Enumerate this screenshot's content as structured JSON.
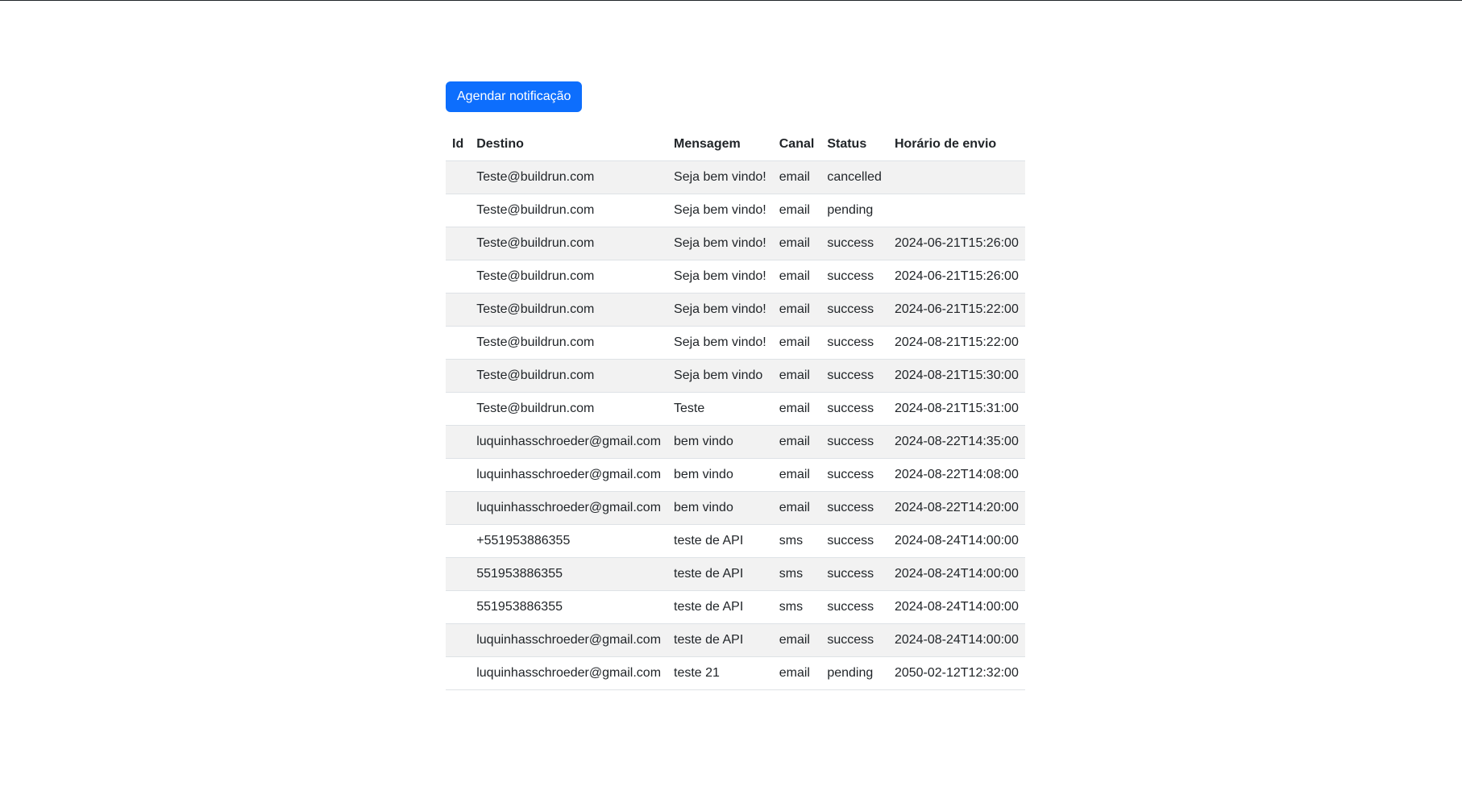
{
  "toolbar": {
    "schedule_label": "Agendar notificação"
  },
  "table": {
    "headers": [
      "Id",
      "Destino",
      "Mensagem",
      "Canal",
      "Status",
      "Horário de envio"
    ],
    "rows": [
      {
        "id": "",
        "destino": "Teste@buildrun.com",
        "mensagem": "Seja bem vindo!",
        "canal": "email",
        "status": "cancelled",
        "horario": ""
      },
      {
        "id": "",
        "destino": "Teste@buildrun.com",
        "mensagem": "Seja bem vindo!",
        "canal": "email",
        "status": "pending",
        "horario": ""
      },
      {
        "id": "",
        "destino": "Teste@buildrun.com",
        "mensagem": "Seja bem vindo!",
        "canal": "email",
        "status": "success",
        "horario": "2024-06-21T15:26:00"
      },
      {
        "id": "",
        "destino": "Teste@buildrun.com",
        "mensagem": "Seja bem vindo!",
        "canal": "email",
        "status": "success",
        "horario": "2024-06-21T15:26:00"
      },
      {
        "id": "",
        "destino": "Teste@buildrun.com",
        "mensagem": "Seja bem vindo!",
        "canal": "email",
        "status": "success",
        "horario": "2024-06-21T15:22:00"
      },
      {
        "id": "",
        "destino": "Teste@buildrun.com",
        "mensagem": "Seja bem vindo!",
        "canal": "email",
        "status": "success",
        "horario": "2024-08-21T15:22:00"
      },
      {
        "id": "",
        "destino": "Teste@buildrun.com",
        "mensagem": "Seja bem vindo",
        "canal": "email",
        "status": "success",
        "horario": "2024-08-21T15:30:00"
      },
      {
        "id": "",
        "destino": "Teste@buildrun.com",
        "mensagem": "Teste",
        "canal": "email",
        "status": "success",
        "horario": "2024-08-21T15:31:00"
      },
      {
        "id": "",
        "destino": "luquinhasschroeder@gmail.com",
        "mensagem": "bem vindo",
        "canal": "email",
        "status": "success",
        "horario": "2024-08-22T14:35:00"
      },
      {
        "id": "",
        "destino": "luquinhasschroeder@gmail.com",
        "mensagem": "bem vindo",
        "canal": "email",
        "status": "success",
        "horario": "2024-08-22T14:08:00"
      },
      {
        "id": "",
        "destino": "luquinhasschroeder@gmail.com",
        "mensagem": "bem vindo",
        "canal": "email",
        "status": "success",
        "horario": "2024-08-22T14:20:00"
      },
      {
        "id": "",
        "destino": "+551953886355",
        "mensagem": "teste de API",
        "canal": "sms",
        "status": "success",
        "horario": "2024-08-24T14:00:00"
      },
      {
        "id": "",
        "destino": "551953886355",
        "mensagem": "teste de API",
        "canal": "sms",
        "status": "success",
        "horario": "2024-08-24T14:00:00"
      },
      {
        "id": "",
        "destino": "551953886355",
        "mensagem": "teste de API",
        "canal": "sms",
        "status": "success",
        "horario": "2024-08-24T14:00:00"
      },
      {
        "id": "",
        "destino": "luquinhasschroeder@gmail.com",
        "mensagem": "teste de API",
        "canal": "email",
        "status": "success",
        "horario": "2024-08-24T14:00:00"
      },
      {
        "id": "",
        "destino": "luquinhasschroeder@gmail.com",
        "mensagem": "teste 21",
        "canal": "email",
        "status": "pending",
        "horario": "2050-02-12T12:32:00"
      }
    ]
  },
  "colors": {
    "accent": "#0d6efd",
    "stripe": "#f2f2f2",
    "border": "#dee2e6",
    "text": "#212529"
  }
}
